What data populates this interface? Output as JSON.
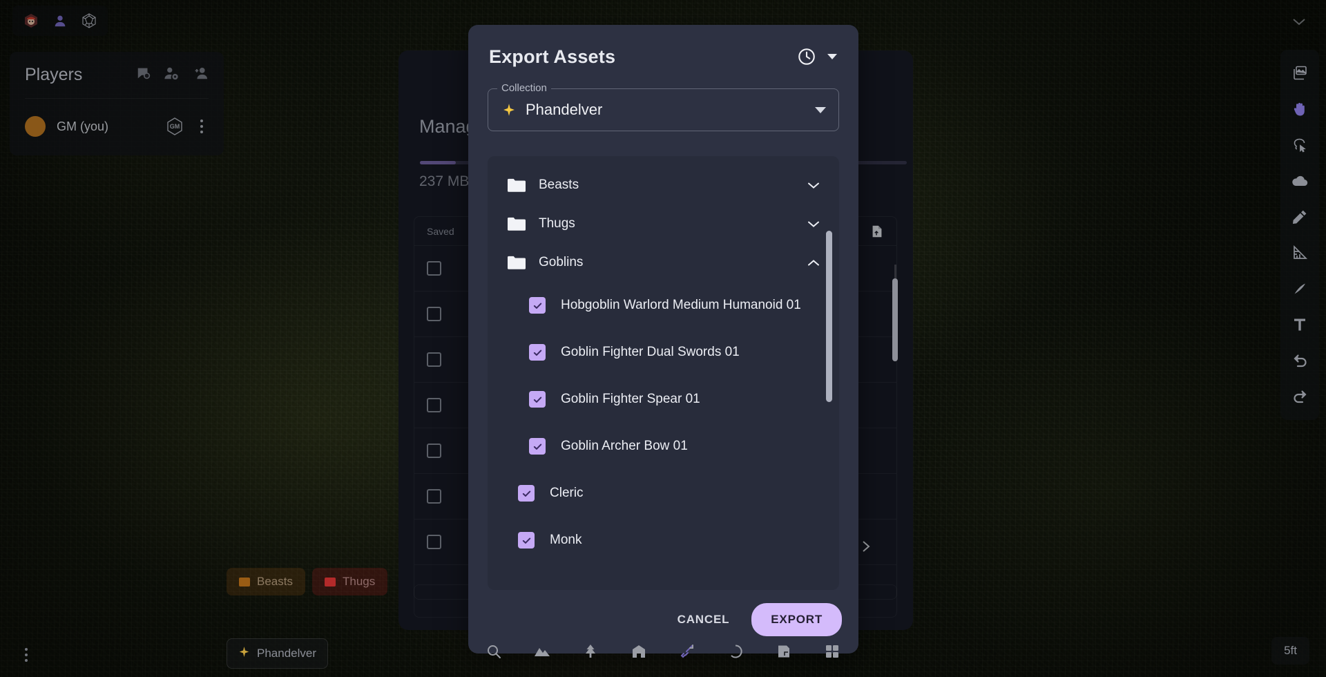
{
  "session": {
    "icons": [
      "gm-avatar-icon",
      "player-icon",
      "dice-d20-icon"
    ],
    "collapse_icon": "chevron-down-icon"
  },
  "players_panel": {
    "title": "Players",
    "header_icons": [
      "chat-bubble-icon",
      "manage-players-icon",
      "add-player-icon"
    ],
    "rows": [
      {
        "name": "GM (you)",
        "badge": "GM",
        "menu_icon": "kebab-menu-icon"
      }
    ]
  },
  "background_dialog": {
    "title": "Manage Assets",
    "storage_used": "237 MB",
    "progress_percent": 7,
    "table": {
      "header": "Saved",
      "upload_icon": "upload-file-icon",
      "row_count": 7
    },
    "next_page_icon": "chevron-right-icon"
  },
  "modal": {
    "title": "Export Assets",
    "history_icon": "clock-history-icon",
    "dropdown_caret_icon": "caret-down-icon",
    "collection": {
      "legend": "Collection",
      "value": "Phandelver",
      "star_icon": "sparkle-star-icon",
      "caret_icon": "caret-down-icon"
    },
    "tree": [
      {
        "type": "folder",
        "label": "Beasts",
        "expanded": false,
        "icon": "folder-icon",
        "chevron": "chevron-down-icon"
      },
      {
        "type": "folder",
        "label": "Thugs",
        "expanded": false,
        "icon": "folder-icon",
        "chevron": "chevron-down-icon"
      },
      {
        "type": "folder",
        "label": "Goblins",
        "expanded": true,
        "icon": "folder-icon",
        "chevron": "chevron-up-icon"
      },
      {
        "type": "asset",
        "label": "Hobgoblin Warlord Medium Humanoid 01",
        "checked": true,
        "indent": true
      },
      {
        "type": "asset",
        "label": "Goblin Fighter Dual Swords 01",
        "checked": true,
        "indent": true
      },
      {
        "type": "asset",
        "label": "Goblin Fighter Spear 01",
        "checked": true,
        "indent": true
      },
      {
        "type": "asset",
        "label": "Goblin Archer Bow 01",
        "checked": true,
        "indent": true
      },
      {
        "type": "asset",
        "label": "Cleric",
        "checked": true,
        "indent": false
      },
      {
        "type": "asset",
        "label": "Monk",
        "checked": true,
        "indent": false
      }
    ],
    "footer": {
      "cancel_label": "CANCEL",
      "export_label": "EXPORT"
    }
  },
  "right_toolbar": {
    "items": [
      {
        "icon": "image-layers-icon",
        "active": false
      },
      {
        "icon": "pan-hand-icon",
        "active": true
      },
      {
        "icon": "lasso-select-icon",
        "active": false
      },
      {
        "icon": "fog-cloud-icon",
        "active": false
      },
      {
        "icon": "pen-draw-icon",
        "active": false
      },
      {
        "icon": "ruler-measure-icon",
        "active": false
      },
      {
        "icon": "eraser-icon",
        "active": false
      },
      {
        "icon": "text-tool-icon",
        "active": false
      },
      {
        "icon": "undo-icon",
        "active": false
      },
      {
        "icon": "redo-icon",
        "active": false
      }
    ]
  },
  "bottom": {
    "chips": [
      {
        "label": "Beasts",
        "color": "#9a5c14"
      },
      {
        "label": "Thugs",
        "color": "#b32a2a"
      }
    ],
    "collection_chip": {
      "label": "Phandelver",
      "icon": "sparkle-star-icon"
    },
    "overflow_icon": "kebab-menu-icon",
    "toolbar_icons": [
      "search-icon",
      "terrain-icon",
      "tree-icon",
      "building-icon",
      "sword-icon",
      "token-circle-icon",
      "notes-icon",
      "assets-grid-icon"
    ],
    "scale": "5ft"
  },
  "colors": {
    "accent": "#c5a9f5",
    "export_button": "#d4bbfb",
    "modal_bg": "#2d3142",
    "list_bg": "#282c3b",
    "background_dialog_bg": "#151822",
    "star": "#f5c842"
  }
}
